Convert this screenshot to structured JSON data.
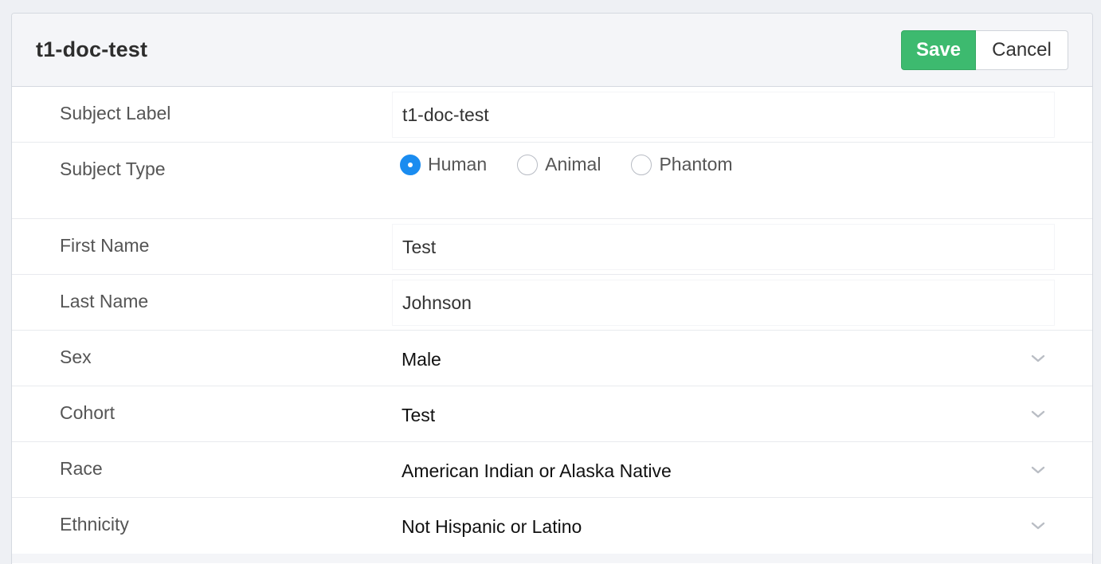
{
  "header": {
    "title": "t1-doc-test",
    "save_label": "Save",
    "cancel_label": "Cancel"
  },
  "colors": {
    "save_button": "#3dba6f",
    "radio_selected": "#1a8cf0",
    "header_background": "#f4f5f8"
  },
  "fields": {
    "subject_label": {
      "label": "Subject Label",
      "value": "t1-doc-test"
    },
    "subject_type": {
      "label": "Subject Type",
      "options": [
        {
          "label": "Human",
          "selected": true
        },
        {
          "label": "Animal",
          "selected": false
        },
        {
          "label": "Phantom",
          "selected": false
        }
      ]
    },
    "first_name": {
      "label": "First Name",
      "value": "Test"
    },
    "last_name": {
      "label": "Last Name",
      "value": "Johnson"
    },
    "sex": {
      "label": "Sex",
      "value": "Male",
      "icon": "chevron-down-icon"
    },
    "cohort": {
      "label": "Cohort",
      "value": "Test",
      "icon": "chevron-down-icon"
    },
    "race": {
      "label": "Race",
      "value": "American Indian or Alaska Native",
      "icon": "chevron-down-icon"
    },
    "ethnicity": {
      "label": "Ethnicity",
      "value": "Not Hispanic or Latino",
      "icon": "chevron-down-icon"
    }
  }
}
